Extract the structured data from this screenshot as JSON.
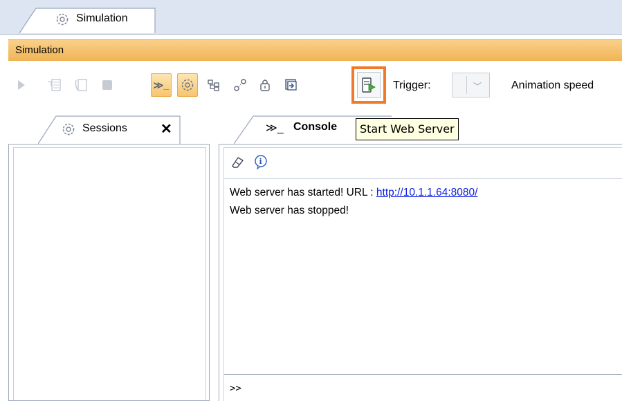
{
  "main_tab": {
    "label": "Simulation",
    "icon": "simulation-gear-icon"
  },
  "title_bar": {
    "label": "Simulation"
  },
  "toolbar": {
    "buttons": [
      {
        "name": "run-icon",
        "enabled": false
      },
      {
        "name": "step-into-icon",
        "enabled": false
      },
      {
        "name": "step-over-icon",
        "enabled": false
      },
      {
        "name": "terminate-icon",
        "enabled": false
      },
      {
        "name": "console-toggle-icon",
        "enabled": true,
        "active": true
      },
      {
        "name": "sessions-toggle-icon",
        "enabled": true,
        "active": true
      },
      {
        "name": "variables-icon",
        "enabled": true
      },
      {
        "name": "breakpoints-icon",
        "enabled": true
      },
      {
        "name": "triggers-icon",
        "enabled": true
      },
      {
        "name": "export-icon",
        "enabled": true
      },
      {
        "name": "start-web-server-icon",
        "enabled": true,
        "highlighted": true
      }
    ],
    "trigger_label": "Trigger:",
    "animation_speed_label": "Animation speed"
  },
  "sessions": {
    "tab_label": "Sessions",
    "close_glyph": "✕"
  },
  "console": {
    "tab_label": "Console",
    "tab_icon_text": "≫_",
    "lines": [
      {
        "text": "Web server has started! URL : ",
        "link": "http://10.1.1.64:8080/"
      },
      {
        "text": "Web server has stopped!"
      }
    ],
    "prompt": ">>"
  },
  "tooltip": {
    "text": "Start Web Server"
  },
  "colors": {
    "accent_orange": "#f07a2a",
    "title_bar": "#f4c16a",
    "link": "#0b1ee0"
  }
}
